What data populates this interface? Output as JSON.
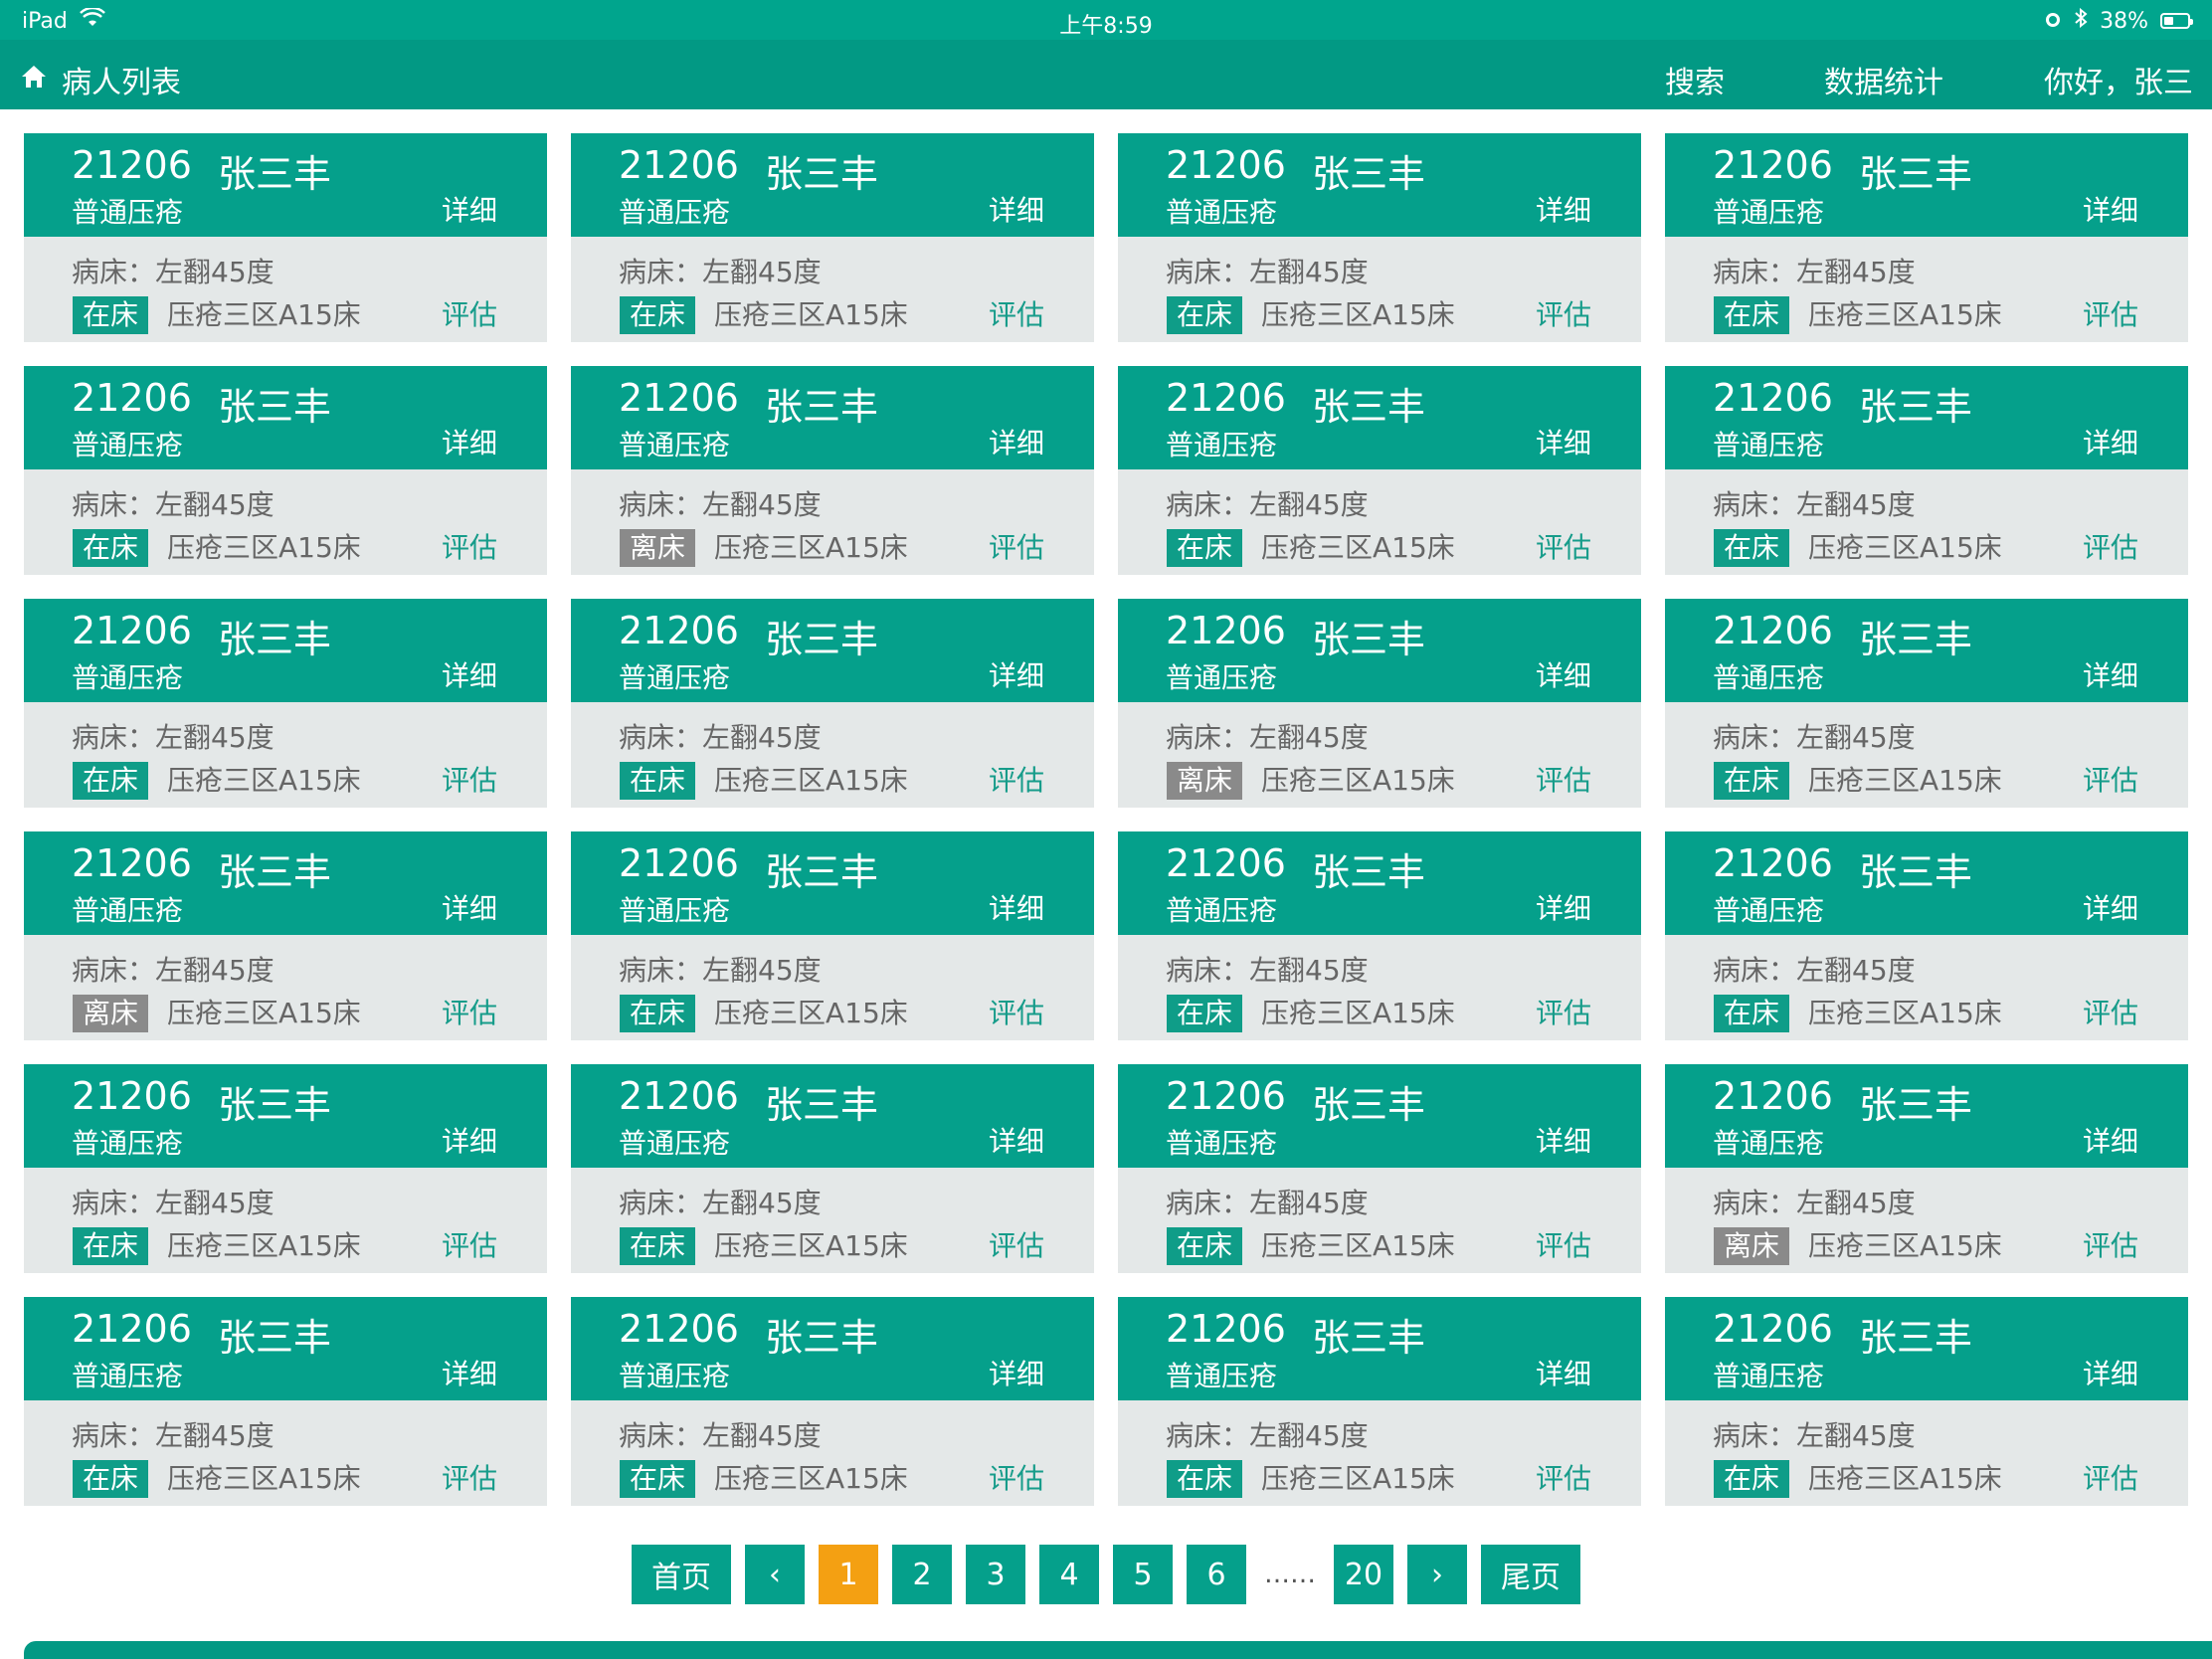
{
  "status_bar": {
    "device": "iPad",
    "time": "上午8:59",
    "battery": "38%"
  },
  "nav": {
    "title": "病人列表",
    "search": "搜索",
    "stats": "数据统计",
    "greeting": "你好，张三"
  },
  "cards": [
    {
      "id": "21206",
      "name": "张三丰",
      "type": "普通压疮",
      "detail": "详细",
      "bed": "病床：左翻45度",
      "status": "在床",
      "location": "压疮三区A15床",
      "evaluate": "评估"
    },
    {
      "id": "21206",
      "name": "张三丰",
      "type": "普通压疮",
      "detail": "详细",
      "bed": "病床：左翻45度",
      "status": "在床",
      "location": "压疮三区A15床",
      "evaluate": "评估"
    },
    {
      "id": "21206",
      "name": "张三丰",
      "type": "普通压疮",
      "detail": "详细",
      "bed": "病床：左翻45度",
      "status": "在床",
      "location": "压疮三区A15床",
      "evaluate": "评估"
    },
    {
      "id": "21206",
      "name": "张三丰",
      "type": "普通压疮",
      "detail": "详细",
      "bed": "病床：左翻45度",
      "status": "在床",
      "location": "压疮三区A15床",
      "evaluate": "评估"
    },
    {
      "id": "21206",
      "name": "张三丰",
      "type": "普通压疮",
      "detail": "详细",
      "bed": "病床：左翻45度",
      "status": "在床",
      "location": "压疮三区A15床",
      "evaluate": "评估"
    },
    {
      "id": "21206",
      "name": "张三丰",
      "type": "普通压疮",
      "detail": "详细",
      "bed": "病床：左翻45度",
      "status": "离床",
      "location": "压疮三区A15床",
      "evaluate": "评估"
    },
    {
      "id": "21206",
      "name": "张三丰",
      "type": "普通压疮",
      "detail": "详细",
      "bed": "病床：左翻45度",
      "status": "在床",
      "location": "压疮三区A15床",
      "evaluate": "评估"
    },
    {
      "id": "21206",
      "name": "张三丰",
      "type": "普通压疮",
      "detail": "详细",
      "bed": "病床：左翻45度",
      "status": "在床",
      "location": "压疮三区A15床",
      "evaluate": "评估"
    },
    {
      "id": "21206",
      "name": "张三丰",
      "type": "普通压疮",
      "detail": "详细",
      "bed": "病床：左翻45度",
      "status": "在床",
      "location": "压疮三区A15床",
      "evaluate": "评估"
    },
    {
      "id": "21206",
      "name": "张三丰",
      "type": "普通压疮",
      "detail": "详细",
      "bed": "病床：左翻45度",
      "status": "在床",
      "location": "压疮三区A15床",
      "evaluate": "评估"
    },
    {
      "id": "21206",
      "name": "张三丰",
      "type": "普通压疮",
      "detail": "详细",
      "bed": "病床：左翻45度",
      "status": "离床",
      "location": "压疮三区A15床",
      "evaluate": "评估"
    },
    {
      "id": "21206",
      "name": "张三丰",
      "type": "普通压疮",
      "detail": "详细",
      "bed": "病床：左翻45度",
      "status": "在床",
      "location": "压疮三区A15床",
      "evaluate": "评估"
    },
    {
      "id": "21206",
      "name": "张三丰",
      "type": "普通压疮",
      "detail": "详细",
      "bed": "病床：左翻45度",
      "status": "离床",
      "location": "压疮三区A15床",
      "evaluate": "评估"
    },
    {
      "id": "21206",
      "name": "张三丰",
      "type": "普通压疮",
      "detail": "详细",
      "bed": "病床：左翻45度",
      "status": "在床",
      "location": "压疮三区A15床",
      "evaluate": "评估"
    },
    {
      "id": "21206",
      "name": "张三丰",
      "type": "普通压疮",
      "detail": "详细",
      "bed": "病床：左翻45度",
      "status": "在床",
      "location": "压疮三区A15床",
      "evaluate": "评估"
    },
    {
      "id": "21206",
      "name": "张三丰",
      "type": "普通压疮",
      "detail": "详细",
      "bed": "病床：左翻45度",
      "status": "在床",
      "location": "压疮三区A15床",
      "evaluate": "评估"
    },
    {
      "id": "21206",
      "name": "张三丰",
      "type": "普通压疮",
      "detail": "详细",
      "bed": "病床：左翻45度",
      "status": "在床",
      "location": "压疮三区A15床",
      "evaluate": "评估"
    },
    {
      "id": "21206",
      "name": "张三丰",
      "type": "普通压疮",
      "detail": "详细",
      "bed": "病床：左翻45度",
      "status": "在床",
      "location": "压疮三区A15床",
      "evaluate": "评估"
    },
    {
      "id": "21206",
      "name": "张三丰",
      "type": "普通压疮",
      "detail": "详细",
      "bed": "病床：左翻45度",
      "status": "在床",
      "location": "压疮三区A15床",
      "evaluate": "评估"
    },
    {
      "id": "21206",
      "name": "张三丰",
      "type": "普通压疮",
      "detail": "详细",
      "bed": "病床：左翻45度",
      "status": "离床",
      "location": "压疮三区A15床",
      "evaluate": "评估"
    },
    {
      "id": "21206",
      "name": "张三丰",
      "type": "普通压疮",
      "detail": "详细",
      "bed": "病床：左翻45度",
      "status": "在床",
      "location": "压疮三区A15床",
      "evaluate": "评估"
    },
    {
      "id": "21206",
      "name": "张三丰",
      "type": "普通压疮",
      "detail": "详细",
      "bed": "病床：左翻45度",
      "status": "在床",
      "location": "压疮三区A15床",
      "evaluate": "评估"
    },
    {
      "id": "21206",
      "name": "张三丰",
      "type": "普通压疮",
      "detail": "详细",
      "bed": "病床：左翻45度",
      "status": "在床",
      "location": "压疮三区A15床",
      "evaluate": "评估"
    },
    {
      "id": "21206",
      "name": "张三丰",
      "type": "普通压疮",
      "detail": "详细",
      "bed": "病床：左翻45度",
      "status": "在床",
      "location": "压疮三区A15床",
      "evaluate": "评估"
    }
  ],
  "pagination": {
    "first": "首页",
    "prev": "‹",
    "pages": [
      "1",
      "2",
      "3",
      "4",
      "5",
      "6"
    ],
    "ellipsis": "……",
    "last_page": "20",
    "next": "›",
    "last": "尾页",
    "current": "1"
  },
  "colors": {
    "primary": "#05a08b",
    "status_off": "#8a8a8a",
    "active_page": "#f4a012"
  }
}
